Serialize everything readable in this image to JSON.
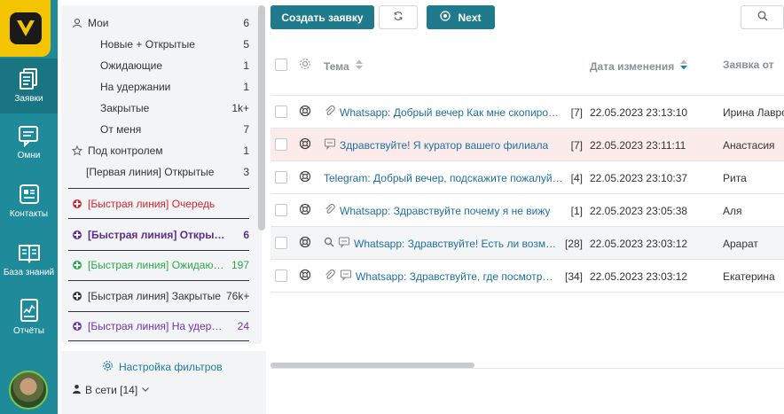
{
  "rail": {
    "items": [
      {
        "label": "Заявки",
        "icon": "tickets-icon"
      },
      {
        "label": "Омни",
        "icon": "omni-chat-icon"
      },
      {
        "label": "Контакты",
        "icon": "contacts-icon"
      },
      {
        "label": "База знаний",
        "icon": "knowledge-base-icon"
      },
      {
        "label": "Отчёты",
        "icon": "reports-icon"
      }
    ]
  },
  "filters": {
    "items": [
      {
        "label": "Мои",
        "count": "6"
      },
      {
        "label": "Новые + Открытые",
        "count": "5"
      },
      {
        "label": "Ожидающие",
        "count": "1"
      },
      {
        "label": "На удержании",
        "count": "1"
      },
      {
        "label": "Закрытые",
        "count": "1k+"
      },
      {
        "label": "От меня",
        "count": "7"
      },
      {
        "label": "Под контролем",
        "count": "1"
      },
      {
        "label": "[Первая линия] Открытые",
        "count": "3"
      },
      {
        "label": "[Быстрая линия] Очередь",
        "count": ""
      },
      {
        "label": "[Быстрая линия] Открытые",
        "count": "6"
      },
      {
        "label": "[Быстрая линия] Ожидающие",
        "count": "197"
      },
      {
        "label": "[Быстрая линия] Закрытые",
        "count": "76k+"
      },
      {
        "label": "[Быстрая линия] На удержании",
        "count": "24"
      }
    ],
    "setup_label": "Настройка фильтров",
    "online_label": "В сети [14]"
  },
  "toolbar": {
    "create_label": "Создать заявку",
    "next_label": "Next"
  },
  "table": {
    "columns": {
      "subject": "Тема",
      "date": "Дата изменения",
      "from": "Заявка от"
    },
    "rows": [
      {
        "subject": "Whatsapp: Добрый вечер Как мне скопировать",
        "count": "[7]",
        "date": "22.05.2023 23:13:10",
        "from": "Ирина Лаврова"
      },
      {
        "subject": "Здравствуйте! Я куратор вашего филиала",
        "count": "[7]",
        "date": "22.05.2023 23:11:11",
        "from": "Анастасия"
      },
      {
        "subject": "Telegram: Добрый вечер, подскажите пожалуйста",
        "count": "[4]",
        "date": "22.05.2023 23:10:37",
        "from": "Рита"
      },
      {
        "subject": "Whatsapp: Здравствуйте почему я не вижу",
        "count": "[1]",
        "date": "22.05.2023 23:05:38",
        "from": "Аля"
      },
      {
        "subject": "Whatsapp: Здравствуйте! Есть ли возможность",
        "count": "[28]",
        "date": "22.05.2023 23:03:12",
        "from": "Арарат"
      },
      {
        "subject": "Whatsapp: Здравствуйте, где посмотреть",
        "count": "[34]",
        "date": "22.05.2023 23:03:12",
        "from": "Екатерина"
      }
    ]
  },
  "colors": {
    "rail": "#1f8a9a",
    "accent": "#1f7a8c",
    "logo": "#f5c400",
    "alert": "#d9232e",
    "purple": "#5b2d8e",
    "green": "#2aa84a"
  }
}
